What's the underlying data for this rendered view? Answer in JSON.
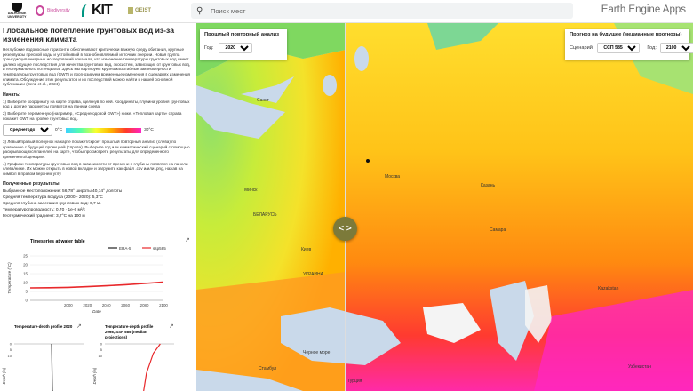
{
  "topbar": {
    "logos": {
      "dalhousie": "DALHOUSIE UNIVERSITY",
      "biodiversity": "Biodiversity",
      "kit": "KIT",
      "geist": "GEIST"
    },
    "search_placeholder": "Поиск мест",
    "brand": "Earth Engine Apps"
  },
  "panel": {
    "title": "Глобальное потепление грунтовых вод из-за изменения климата",
    "intro": "Неглубокие водоносные горизонты обеспечивают критически важную среду обитания, крупные резервуары пресной воды и устойчивый в вознобновляемый источник энергии. Новая группа трансдисциплинарных исследований показала, что изменение температуры грунтовых вод имеет далеко идущие последствия для качества грунтовых вод, экосистем, зависящих от грунтовых вод, и геотермального потенциала. Здесь мы картируем крупномасштабные закономерности температуры грунтовых вод (GWT) и прогнозируем временные изменения в сценариях изменения климата. Обсуждение этих результатов и их последствий можно найти в нашей основной публикации (Benz et al., 2024).",
    "start_label": "Начать:",
    "steps": [
      "1) Выберите координату на карте справа, щелкнув по ней. Координаты, глубина уровня грунтовых вод и другие параметры появятся на панели слева.",
      "2) Выберите переменную (например, «Среднегодовой GWT») ниже. «Тепловая карта» справа покажет GWT на уровне грунтовых вод."
    ],
    "steps_after": [
      "3) Левый/правый полоунок на карте покажет/скроет прошлый повторный анализ (слева) по сравнению с будущей проекцией (справа). Выберите год или климатический сценарий с помощью раскрывающихся панелей на карте, чтобы просмотреть результаты для определенного временного/сценария.",
      "4) Графики температуры грунтовых вод в зависимости от времени и глубины появятся на панели слева/ниже. Их можно открыть в новой вкладке и загрузить как файл .csv и/или .png, нажав на символ в правом верхнем углу."
    ],
    "gwt_select": "Среднегодовой GWT",
    "gwt_min": "0°C",
    "gwt_max": "30°C",
    "results_label": "Полученные результаты:",
    "results": [
      "Выбранное местоположение: 56,78° широты 40,14° долготы",
      "Средняя температура воздуха (2000 - 2020): 5,3°C",
      "Средняя глубина залегания грунтовых вод: 6,7 м.",
      "Температуропроводность: 0,70 · 1e-6 м²/с",
      "Геотермический градиент: 3,7°C на 100 м"
    ]
  },
  "chart_data": [
    {
      "type": "line",
      "title": "Timeseries at water table",
      "xlabel": "Date",
      "ylabel": "Temperature (°C)",
      "xlim": [
        1960,
        2100
      ],
      "ylim": [
        0,
        25
      ],
      "x_ticks": [
        2000,
        2020,
        2040,
        2060,
        2080,
        2100
      ],
      "y_ticks": [
        0,
        5,
        10,
        15,
        20,
        25
      ],
      "legend": "top-right",
      "series": [
        {
          "name": "ERA-5",
          "color": "#222222",
          "x": [],
          "y": []
        },
        {
          "name": "ssp585",
          "color": "#e8282b",
          "x": [
            1960,
            1980,
            2000,
            2020,
            2040,
            2060,
            2080,
            2100
          ],
          "y": [
            7.0,
            7.1,
            7.3,
            7.7,
            8.2,
            8.8,
            9.5,
            10.3
          ]
        }
      ]
    },
    {
      "type": "line",
      "title": "Temperature-depth profile 2020",
      "xlabel": "",
      "ylabel": "Depth (m)",
      "xlim": [
        0,
        10
      ],
      "ylim": [
        0,
        100
      ],
      "series": [
        {
          "name": "",
          "color": "#222222",
          "x": [
            5.4,
            5.5,
            5.6
          ],
          "y": [
            0,
            50,
            100
          ]
        }
      ]
    },
    {
      "type": "line",
      "title": "Temperature-depth profile 2098, SSP 585 (median projections)",
      "xlabel": "",
      "ylabel": "Depth (m)",
      "xlim": [
        0,
        10
      ],
      "ylim": [
        0,
        100
      ],
      "series": [
        {
          "name": "",
          "color": "#e8282b",
          "x": [
            8.0,
            7.0,
            6.0,
            5.6
          ],
          "y": [
            0,
            8,
            25,
            100
          ]
        }
      ]
    }
  ],
  "map": {
    "left_card": {
      "title": "Прошлый повторный анализ",
      "year_label": "Год:",
      "year": "2020"
    },
    "right_card": {
      "title": "Прогноз на будущее (медианные прогнозы)",
      "scenario_label": "Сценарий:",
      "scenario": "ССП 585",
      "year_label": "Год:",
      "year": "2100"
    },
    "swipe_icon": "< >",
    "places": [
      "Санкт",
      "Минск",
      "БЕЛАРУСЬ",
      "Киев",
      "УКРАИНА",
      "Москва",
      "Казань",
      "Самара",
      "Kazakstan",
      "Черное море",
      "Стамбул",
      "Турция",
      "Узбекистан"
    ]
  },
  "colors": {
    "accent": "#7c7a3a",
    "series_red": "#e8282b"
  }
}
